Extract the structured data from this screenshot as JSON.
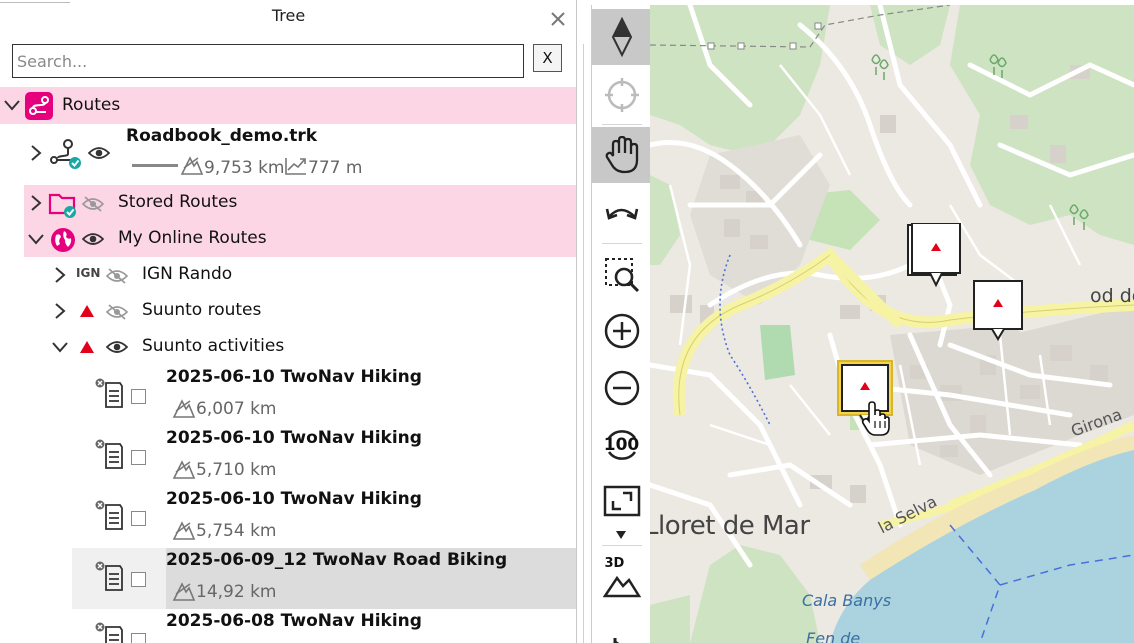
{
  "panel": {
    "title": "Tree",
    "search": {
      "placeholder": "Search...",
      "value": "",
      "clear_label": "X"
    }
  },
  "tree": {
    "routes": {
      "label": "Routes"
    },
    "roadbook": {
      "name": "Roadbook_demo.trk",
      "distance": "9,753 km",
      "elevation": "777 m"
    },
    "stored_routes": {
      "label": "Stored Routes"
    },
    "online_routes": {
      "label": "My Online Routes"
    },
    "ign": {
      "label": "IGN Rando",
      "badge": "IGN"
    },
    "suunto_routes": {
      "label": "Suunto routes"
    },
    "suunto_activities": {
      "label": "Suunto activities"
    },
    "activities": [
      {
        "name": "2025-06-10  TwoNav Hiking",
        "distance": "6,007 km",
        "selected": false
      },
      {
        "name": "2025-06-10  TwoNav Hiking",
        "distance": "5,710 km",
        "selected": false
      },
      {
        "name": "2025-06-10  TwoNav Hiking",
        "distance": "5,754 km",
        "selected": false
      },
      {
        "name": "2025-06-09_12 TwoNav Road Biking",
        "distance": "14,92 km",
        "selected": true
      },
      {
        "name": "2025-06-08  TwoNav Hiking",
        "distance": "",
        "selected": false
      }
    ]
  },
  "toolbar": {
    "tools": [
      "compass-icon",
      "locate-icon",
      "pan-hand-icon",
      "undo-icon",
      "zoom-area-icon",
      "zoom-in-icon",
      "zoom-out-icon",
      "zoom-100-icon",
      "fit-screen-icon",
      "3d-view-icon"
    ],
    "zoom100_label": "100",
    "label_3d": "3D"
  },
  "map": {
    "labels": {
      "town": "Lloret de Mar",
      "street1": "la Selva",
      "street2": "Girona",
      "place": "Cala Banys",
      "partial_right": "od de",
      "partial_bottom": "Fen de"
    }
  },
  "colors": {
    "pink_row": "#fdd6e5",
    "accent": "#e6007e",
    "teal_check": "#19a8a5",
    "marker_red": "#e2001a",
    "water": "#aad3df"
  }
}
